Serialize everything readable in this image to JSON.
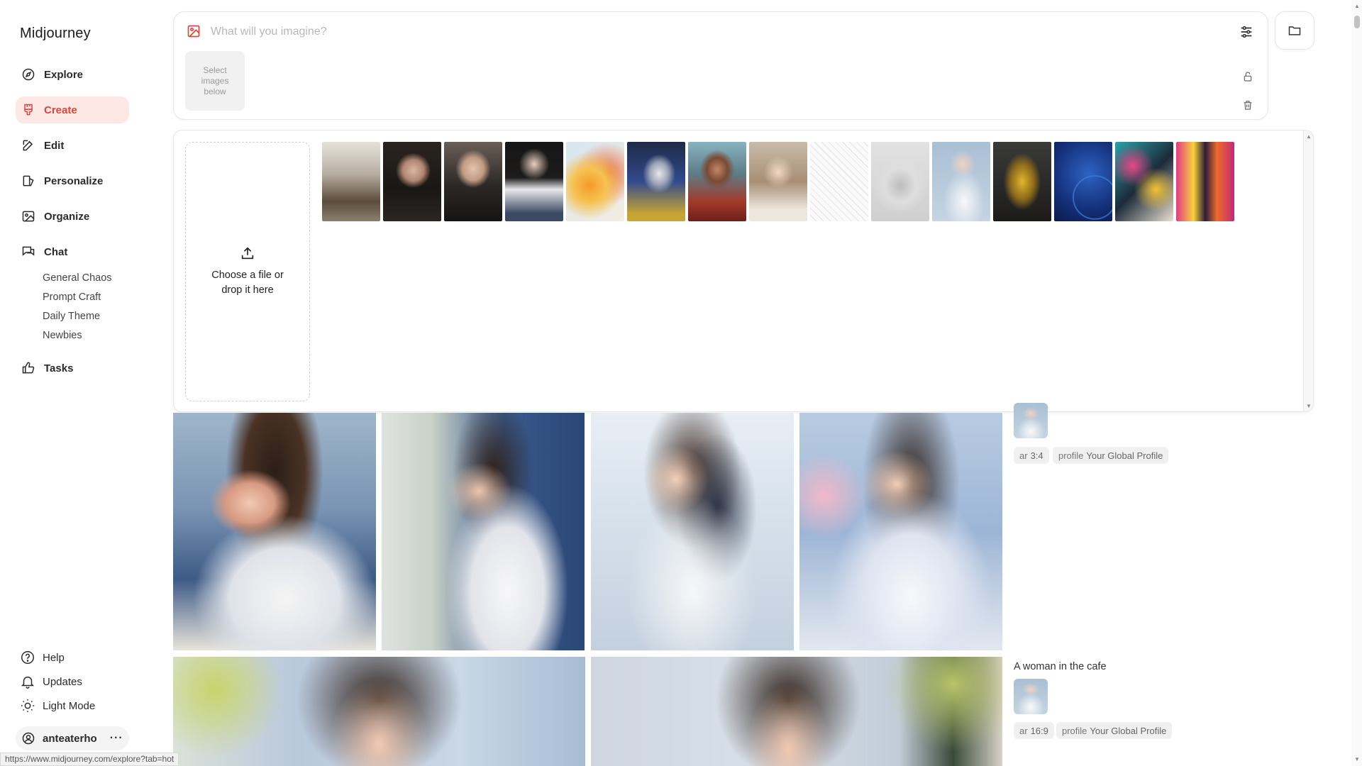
{
  "app": {
    "title": "Midjourney"
  },
  "sidebar": {
    "nav": [
      {
        "label": "Explore",
        "icon": "compass-icon"
      },
      {
        "label": "Create",
        "icon": "brush-icon",
        "active": true
      },
      {
        "label": "Edit",
        "icon": "edit-icon"
      },
      {
        "label": "Personalize",
        "icon": "personalize-icon"
      },
      {
        "label": "Organize",
        "icon": "image-icon"
      },
      {
        "label": "Chat",
        "icon": "chat-icon"
      },
      {
        "label": "Tasks",
        "icon": "thumbs-up-icon"
      }
    ],
    "chat_channels": [
      "General Chaos",
      "Prompt Craft",
      "Daily Theme",
      "Newbies"
    ],
    "footer": [
      {
        "label": "Help",
        "icon": "help-icon"
      },
      {
        "label": "Updates",
        "icon": "bell-icon"
      },
      {
        "label": "Light Mode",
        "icon": "sun-icon"
      }
    ],
    "user": {
      "name": "anteaterho",
      "more": "···"
    }
  },
  "prompt": {
    "placeholder": "What will you imagine?",
    "select_images": "Select images below"
  },
  "upload": {
    "dropzone_text": "Choose a file or drop it here",
    "thumbnails": [
      "winter-coat-woman",
      "dark-hair-portrait",
      "woman-black-blazer",
      "woman-white-top",
      "orange-paint-cloud",
      "mecha-robot",
      "colorful-warrior",
      "woman-cafe-laptop",
      "sketch-drawing",
      "pencil-hand-sketch",
      "ponytail-girl-white-shirt",
      "yellow-mech",
      "blue-abstract-circle",
      "pop-art-mech",
      "neon-city-street"
    ]
  },
  "gallery": {
    "rows": [
      {
        "title": "",
        "chips": [
          {
            "key": "ar",
            "value": "3:4"
          },
          {
            "key": "profile",
            "value": "Your Global Profile"
          }
        ]
      },
      {
        "title": "A woman in the cafe",
        "chips": [
          {
            "key": "ar",
            "value": "16:9"
          },
          {
            "key": "profile",
            "value": "Your Global Profile"
          }
        ]
      }
    ]
  },
  "status_bar": {
    "url": "https://www.midjourney.com/explore?tab=hot"
  },
  "colors": {
    "accent": "#e0453a",
    "active_bg": "#fde8e6"
  }
}
